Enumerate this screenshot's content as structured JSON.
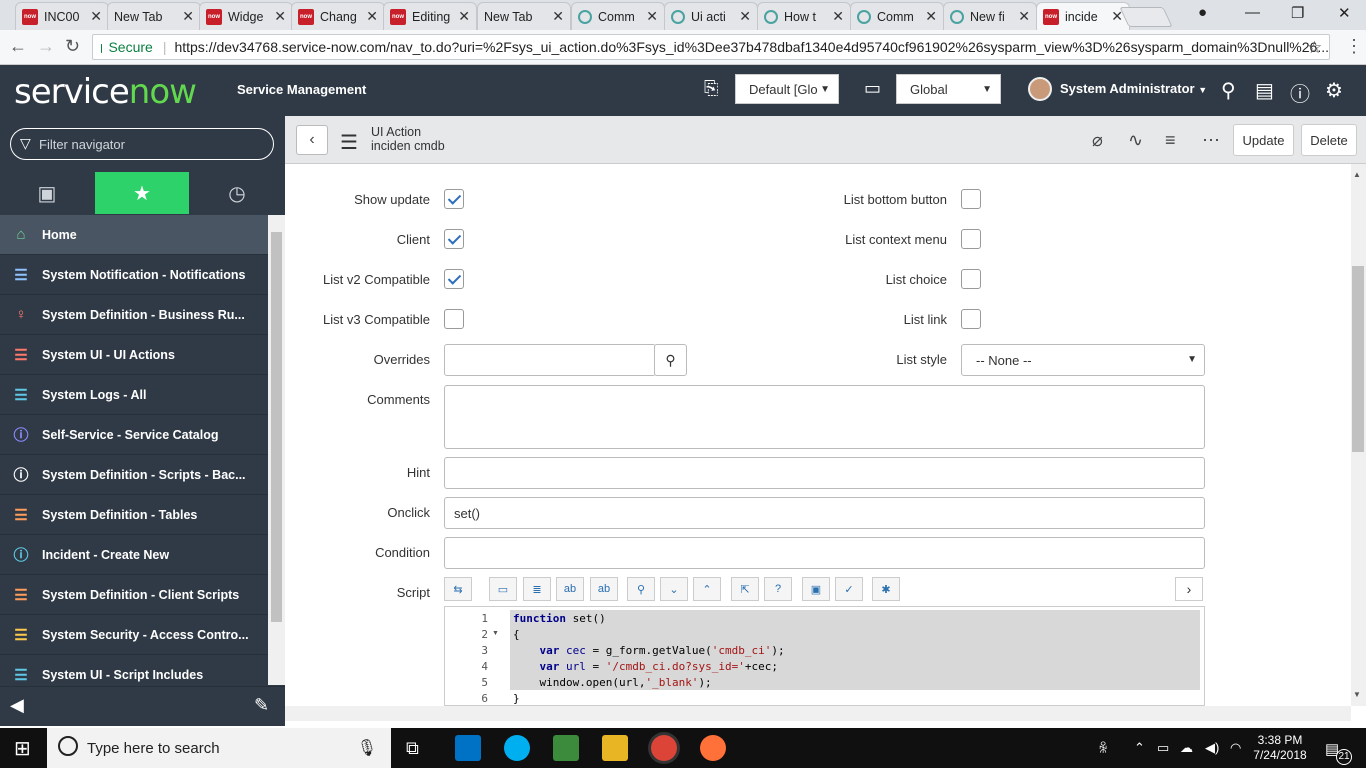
{
  "browser": {
    "tabs": [
      {
        "label": "INC00",
        "favicon": "now",
        "active": false
      },
      {
        "label": "New Tab",
        "favicon": "none",
        "active": false
      },
      {
        "label": "Widge",
        "favicon": "now",
        "active": false
      },
      {
        "label": "Chang",
        "favicon": "now",
        "active": false
      },
      {
        "label": "Editing",
        "favicon": "now",
        "active": false
      },
      {
        "label": "New Tab",
        "favicon": "none",
        "active": false
      },
      {
        "label": "Comm",
        "favicon": "ring",
        "active": false
      },
      {
        "label": "Ui acti",
        "favicon": "ring",
        "active": false
      },
      {
        "label": "How t",
        "favicon": "ring",
        "active": false
      },
      {
        "label": "Comm",
        "favicon": "ring",
        "active": false
      },
      {
        "label": "New fi",
        "favicon": "ring",
        "active": false
      },
      {
        "label": "incide",
        "favicon": "now",
        "active": true
      }
    ],
    "secure_label": "Secure",
    "url": "https://dev34768.service-now.com/nav_to.do?uri=%2Fsys_ui_action.do%3Fsys_id%3Dee37b478dbaf1340e4d95740cf961902%26sysparm_view%3D%26sysparm_domain%3Dnull%26..."
  },
  "header": {
    "logo_service": "service",
    "logo_now": "now",
    "product": "Service Management",
    "update_set": "Default [Glo",
    "application": "Global",
    "user": "System Administrator"
  },
  "nav": {
    "filter_placeholder": "Filter navigator",
    "items": [
      {
        "label": "Home",
        "icon": "home-icon",
        "glyph": "⌂",
        "color": "#6bd28f"
      },
      {
        "label": "System Notification - Notifications",
        "icon": "list-icon",
        "glyph": "☰",
        "color": "#8fc3ff"
      },
      {
        "label": "System Definition - Business Ru...",
        "icon": "bulb-icon",
        "glyph": "♀",
        "color": "#ff7a6b"
      },
      {
        "label": "System UI - UI Actions",
        "icon": "list-icon",
        "glyph": "☰",
        "color": "#ff7a6b"
      },
      {
        "label": "System Logs - All",
        "icon": "list-icon",
        "glyph": "☰",
        "color": "#5ec8e5"
      },
      {
        "label": "Self-Service - Service Catalog",
        "icon": "info-icon",
        "glyph": "ⓘ",
        "color": "#8b8bff"
      },
      {
        "label": "System Definition - Scripts - Bac...",
        "icon": "info-icon",
        "glyph": "ⓘ",
        "color": "#ffffff"
      },
      {
        "label": "System Definition - Tables",
        "icon": "list-icon",
        "glyph": "☰",
        "color": "#ff9d5c"
      },
      {
        "label": "Incident - Create New",
        "icon": "info-icon",
        "glyph": "ⓘ",
        "color": "#5ec8e5"
      },
      {
        "label": "System Definition - Client Scripts",
        "icon": "list-icon",
        "glyph": "☰",
        "color": "#ff9d5c"
      },
      {
        "label": "System Security - Access Contro...",
        "icon": "list-icon",
        "glyph": "☰",
        "color": "#ffc94d"
      },
      {
        "label": "System UI - Script Includes",
        "icon": "list-icon",
        "glyph": "☰",
        "color": "#5ec8e5"
      }
    ]
  },
  "form": {
    "record_type": "UI Action",
    "record_name": "inciden cmdb",
    "update_label": "Update",
    "delete_label": "Delete",
    "left_checks": [
      {
        "label": "Show update",
        "checked": true
      },
      {
        "label": "Client",
        "checked": true
      },
      {
        "label": "List v2 Compatible",
        "checked": true
      },
      {
        "label": "List v3 Compatible",
        "checked": false
      }
    ],
    "right_checks": [
      {
        "label": "List bottom button",
        "checked": false
      },
      {
        "label": "List context menu",
        "checked": false
      },
      {
        "label": "List choice",
        "checked": false
      },
      {
        "label": "List link",
        "checked": false
      }
    ],
    "overrides_label": "Overrides",
    "list_style_label": "List style",
    "list_style_value": "-- None --",
    "comments_label": "Comments",
    "hint_label": "Hint",
    "onclick_label": "Onclick",
    "onclick_value": "set()",
    "condition_label": "Condition",
    "script_label": "Script",
    "script_lines": [
      "1",
      "2",
      "3",
      "4",
      "5",
      "6"
    ]
  },
  "taskbar": {
    "search_placeholder": "Type here to search",
    "time": "3:38 PM",
    "date": "7/24/2018",
    "notifications": "21"
  }
}
